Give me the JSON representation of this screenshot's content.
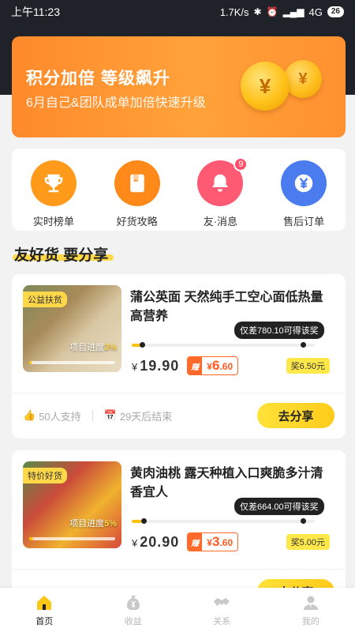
{
  "status": {
    "time": "上午11:23",
    "speed": "1.7K/s",
    "network": "4G",
    "battery": "26"
  },
  "banner": {
    "title": "积分加倍 等级飙升",
    "subtitle": "6月自己&团队成单加倍快速升级",
    "coin_symbol": "¥"
  },
  "menu": {
    "items": [
      {
        "label": "实时榜单",
        "icon": "trophy-icon",
        "color": "#ff9a1a"
      },
      {
        "label": "好货攻略",
        "icon": "book-icon",
        "color": "#ff8a1a"
      },
      {
        "label": "友·消息",
        "icon": "bell-icon",
        "color": "#ff5a73",
        "badge": "9"
      },
      {
        "label": "售后订单",
        "icon": "yen-refresh-icon",
        "color": "#4a7cf0"
      }
    ]
  },
  "section": {
    "title": "友好货 要分享"
  },
  "products": [
    {
      "tag": "公益扶贫",
      "title": "蒲公英面 天然纯手工空心面低热量高营养",
      "progress_label": "项目进度",
      "progress_value": "3%",
      "tooltip": "仅差780.10可得该奖",
      "price_symbol": "¥",
      "price": "19.90",
      "earn_tag": "赚",
      "earn_symbol": "¥",
      "earn_int": "6",
      "earn_dec": ".60",
      "bonus": "奖6.50元",
      "supporters": "50人支持",
      "ends": "29天后结束",
      "share": "去分享"
    },
    {
      "tag": "特价好货",
      "title": "黄肉油桃 露天种植入口爽脆多汁清香宜人",
      "progress_label": "项目进度",
      "progress_value": "5%",
      "tooltip": "仅差664.00可得该奖",
      "price_symbol": "¥",
      "price": "20.90",
      "earn_tag": "赚",
      "earn_symbol": "¥",
      "earn_int": "3",
      "earn_dec": ".60",
      "bonus": "奖5.00元",
      "share": "去分享"
    }
  ],
  "tabbar": {
    "items": [
      {
        "label": "首页",
        "icon": "home-icon",
        "active": true
      },
      {
        "label": "收益",
        "icon": "money-bag-icon"
      },
      {
        "label": "关系",
        "icon": "handshake-icon"
      },
      {
        "label": "我的",
        "icon": "user-icon"
      }
    ]
  },
  "colors": {
    "accent": "#ffd84a",
    "orange": "#ff6a2b",
    "dark": "#1f2228"
  }
}
